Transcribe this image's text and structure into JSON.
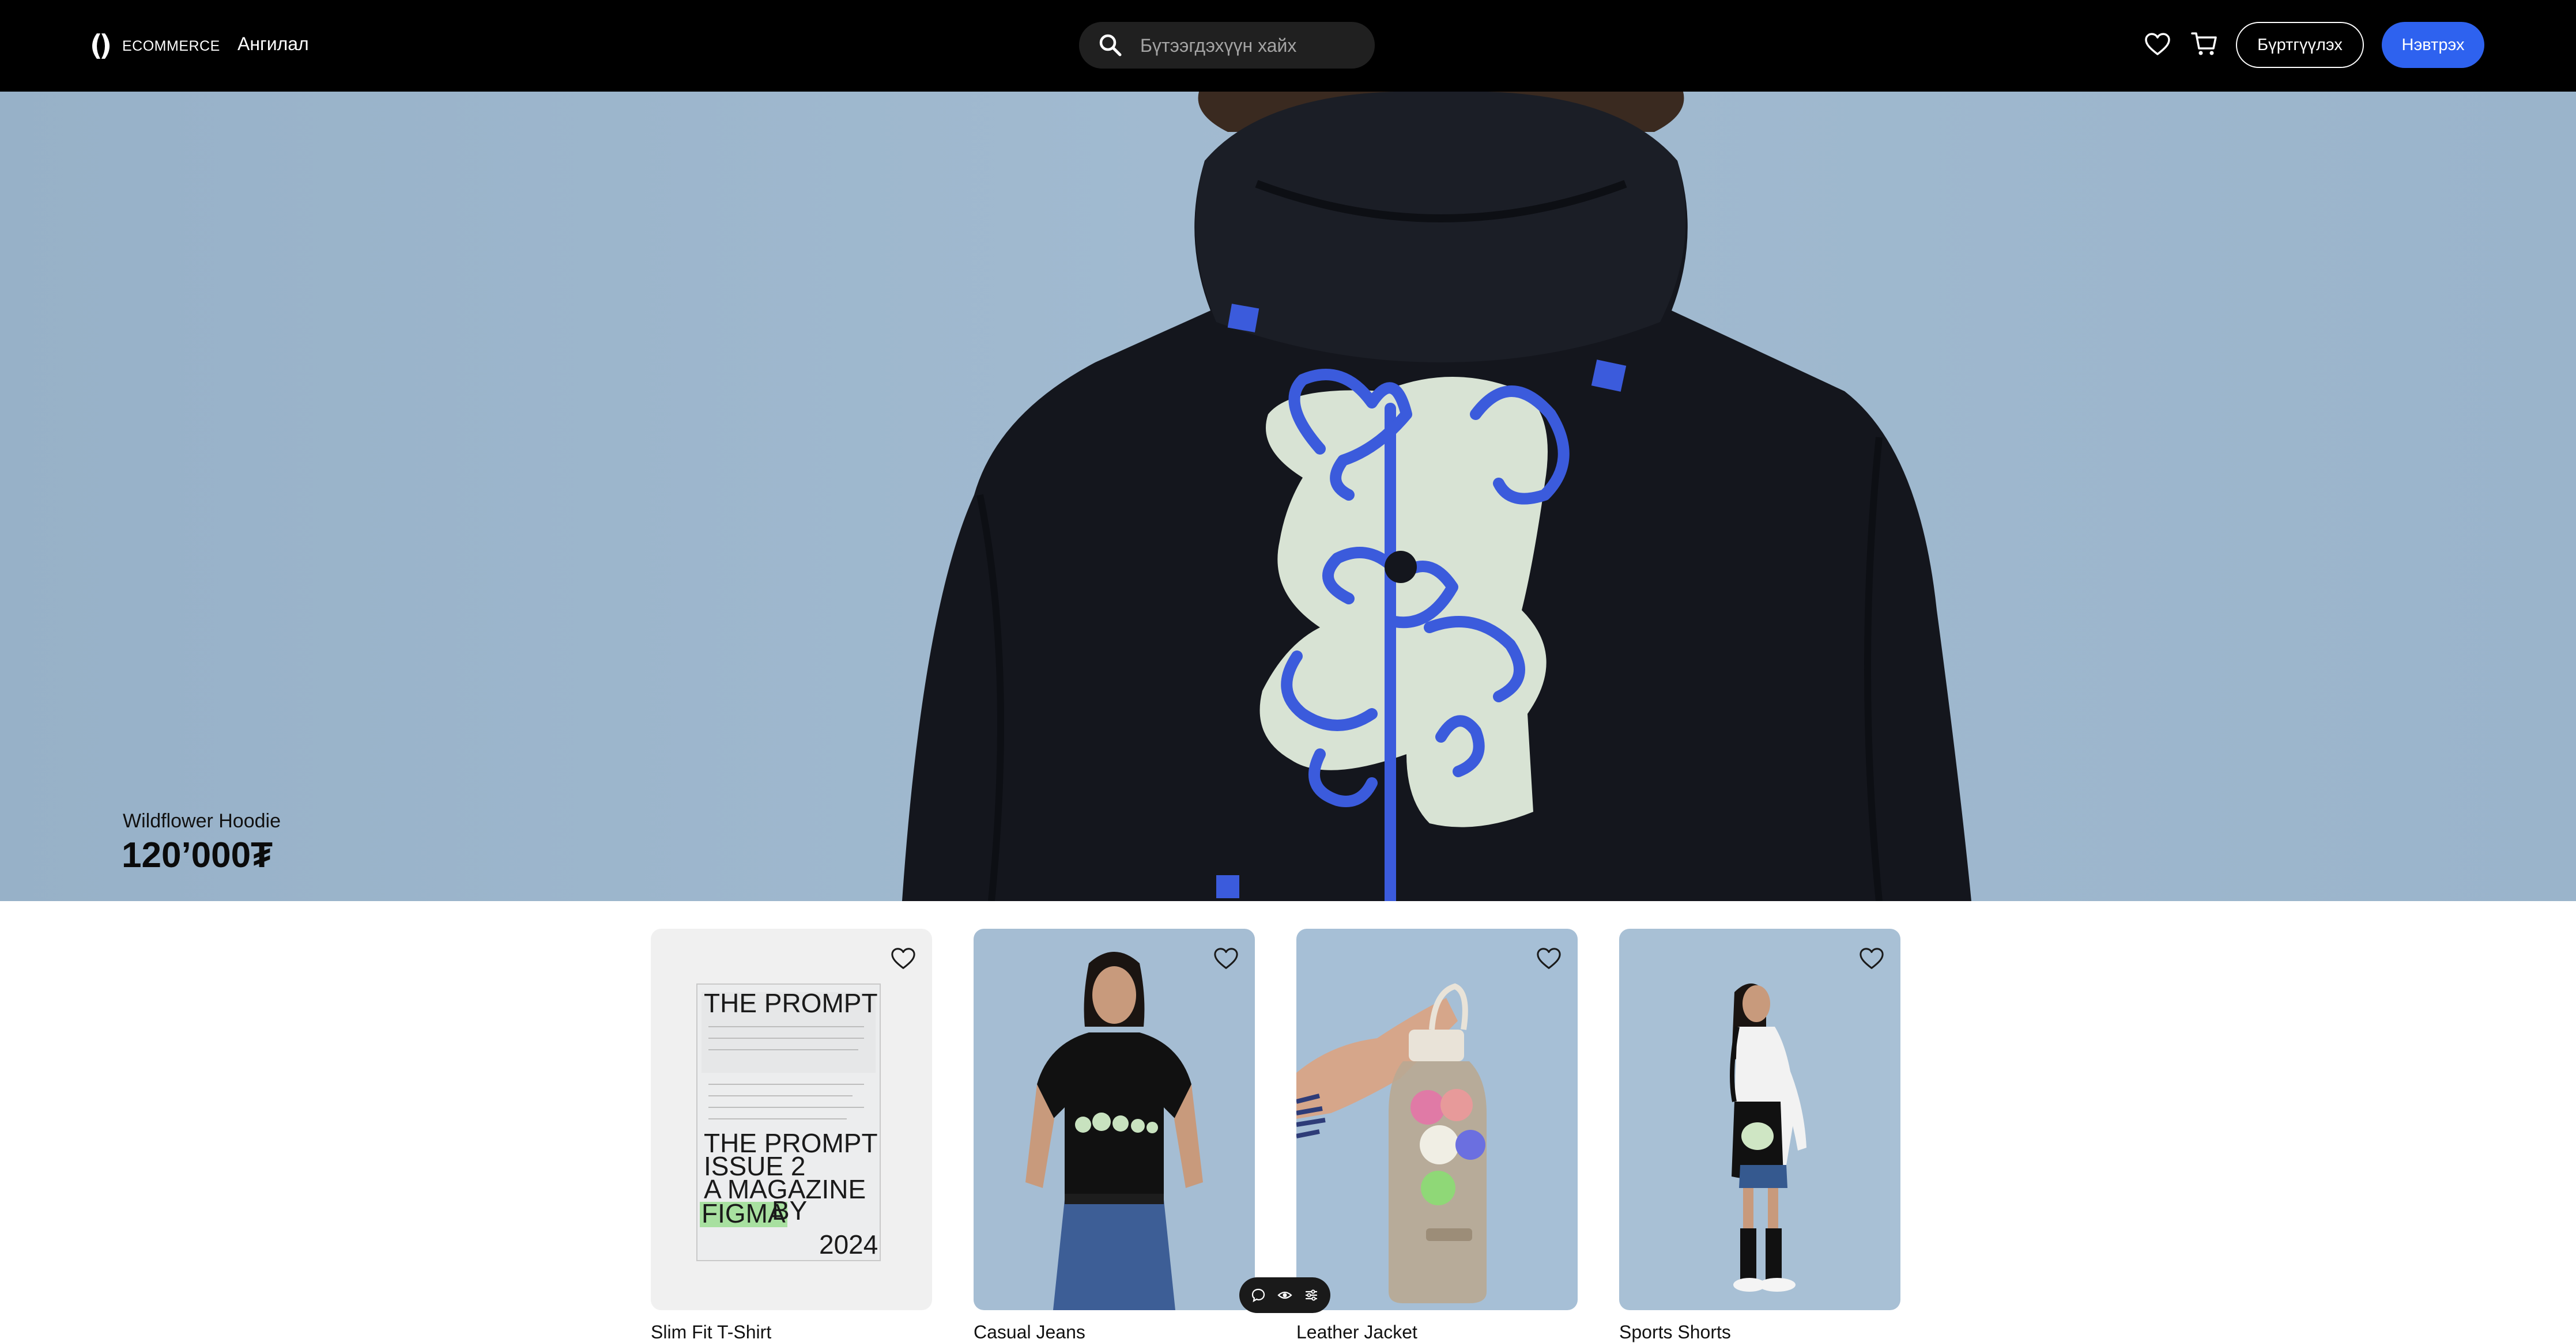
{
  "header": {
    "logo_text": "ECOMMERCE",
    "category_label": "Ангилал",
    "search_placeholder": "Бүтээгдэхүүн хайх",
    "register_label": "Бүртгүүлэх",
    "login_label": "Нэвтрэх"
  },
  "hero": {
    "product_name": "Wildflower Hoodie",
    "price": "120’000₮"
  },
  "products": [
    {
      "name": "Slim Fit T-Shirt",
      "image": "magazine-image"
    },
    {
      "name": "Casual Jeans",
      "image": "tshirt-model-image"
    },
    {
      "name": "Leather Jacket",
      "image": "water-bottle-image"
    },
    {
      "name": "Sports Shorts",
      "image": "tote-bag-model-image"
    }
  ],
  "magazine": {
    "top": "THE  PROMPT",
    "line1": "THE  PROMPT",
    "line2": "ISSUE 2",
    "line3": "A  MAGAZINE",
    "line4": "BY",
    "line5": "FIGMA",
    "line6": "2024"
  },
  "colors": {
    "header_bg": "#000000",
    "accent": "#2e62ef",
    "hero_bg": "#9cb6cd"
  },
  "icons": [
    "logo-icon",
    "search-icon",
    "heart-icon",
    "cart-icon",
    "comment-icon",
    "eye-icon",
    "settings-icon"
  ]
}
